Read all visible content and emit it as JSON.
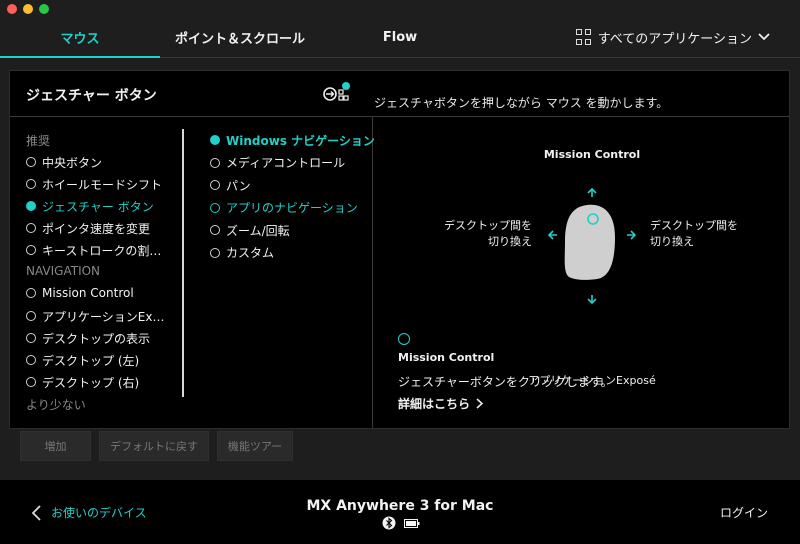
{
  "tabs": [
    {
      "label": "マウス",
      "active": true
    },
    {
      "label": "ポイント＆スクロール",
      "active": false
    },
    {
      "label": "Flow",
      "active": false
    }
  ],
  "apps_selector": {
    "label": "すべてのアプリケーション"
  },
  "panel": {
    "title": "ジェスチャー ボタン",
    "description": "ジェスチャボタンを押しながら マウス を動かします。"
  },
  "left_list": {
    "recommended_label": "推奨",
    "recommended": [
      {
        "label": "中央ボタン"
      },
      {
        "label": "ホイールモードシフト"
      },
      {
        "label": "ジェスチャー ボタン",
        "active": true
      },
      {
        "label": "ポインタ速度を変更"
      },
      {
        "label": "キーストロークの割…"
      }
    ],
    "navigation_label": "NAVIGATION",
    "navigation": [
      {
        "label": "Mission Control"
      },
      {
        "label": "アプリケーションEx…"
      },
      {
        "label": "デスクトップの表示"
      },
      {
        "label": "デスクトップ (左)"
      },
      {
        "label": "デスクトップ (右)"
      }
    ],
    "less_label": "より少ない"
  },
  "mid_list": [
    {
      "label": "Windows ナビゲーション",
      "active": true
    },
    {
      "label": "メディアコントロール"
    },
    {
      "label": "パン"
    },
    {
      "label": "アプリのナビゲーション",
      "teal": true
    },
    {
      "label": "ズーム/回転"
    },
    {
      "label": "カスタム"
    }
  ],
  "gesture": {
    "up_label": "Mission Control",
    "left_label_1": "デスクトップ間を",
    "left_label_2": "切り換え",
    "right_label_1": "デスクトップ間を",
    "right_label_2": "切り換え",
    "down_label": "アプリケーションExposé",
    "click_title": "Mission Control",
    "click_desc": "ジェスチャーボタンをクリックします。",
    "more_link": "詳細はこちら"
  },
  "buttons": {
    "add": "増加",
    "reset": "デフォルトに戻す",
    "tour": "機能ツアー"
  },
  "footer": {
    "back": "お使いのデバイス",
    "device": "MX Anywhere 3 for Mac",
    "login": "ログイン"
  },
  "colors": {
    "accent": "#1fd1c8",
    "background": "#1e1e1e",
    "panel": "#000000"
  }
}
